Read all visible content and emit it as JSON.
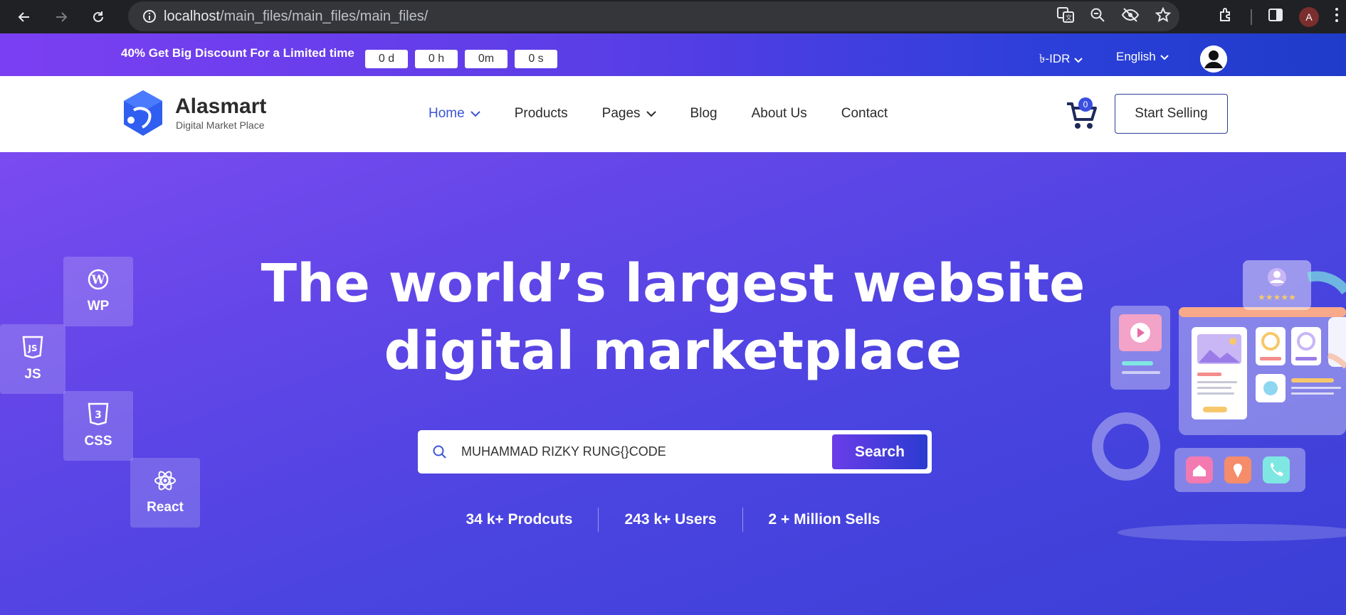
{
  "browser": {
    "url_host": "localhost",
    "url_path": "/main_files/main_files/main_files/",
    "profile_initial": "A"
  },
  "promo": {
    "discount_bold": "40%",
    "discount_text": " Get Big Discount For a Limited time",
    "countdown": [
      "0 d",
      "0 h",
      "0m",
      "0 s"
    ],
    "currency": "৳-IDR",
    "language": "English"
  },
  "header": {
    "logo_name": "Alasmart",
    "logo_tagline": "Digital Market Place",
    "menu": [
      {
        "label": "Home",
        "has_dropdown": true,
        "active": true
      },
      {
        "label": "Products",
        "has_dropdown": false,
        "active": false
      },
      {
        "label": "Pages",
        "has_dropdown": true,
        "active": false
      },
      {
        "label": "Blog",
        "has_dropdown": false,
        "active": false
      },
      {
        "label": "About Us",
        "has_dropdown": false,
        "active": false
      },
      {
        "label": "Contact",
        "has_dropdown": false,
        "active": false
      }
    ],
    "cart_count": "0",
    "start_selling_label": "Start Selling"
  },
  "hero": {
    "title_line1": "The world’s largest website",
    "title_line2": "digital marketplace",
    "search_value": "MUHAMMAD RIZKY RUNG{}CODE",
    "search_button": "Search",
    "stats": [
      "34 k+ Prodcuts",
      "243 k+ Users",
      "2 + Million Sells"
    ],
    "tiles": [
      {
        "label": "WP",
        "icon": "wordpress-icon"
      },
      {
        "label": "JS",
        "icon": "javascript-icon"
      },
      {
        "label": "CSS",
        "icon": "css3-icon"
      },
      {
        "label": "React",
        "icon": "react-icon"
      }
    ]
  },
  "colors": {
    "accent": "#3a55d6",
    "hero_start": "#7a4bf0",
    "hero_end": "#3a3fd6",
    "chrome_bg": "#202124"
  }
}
